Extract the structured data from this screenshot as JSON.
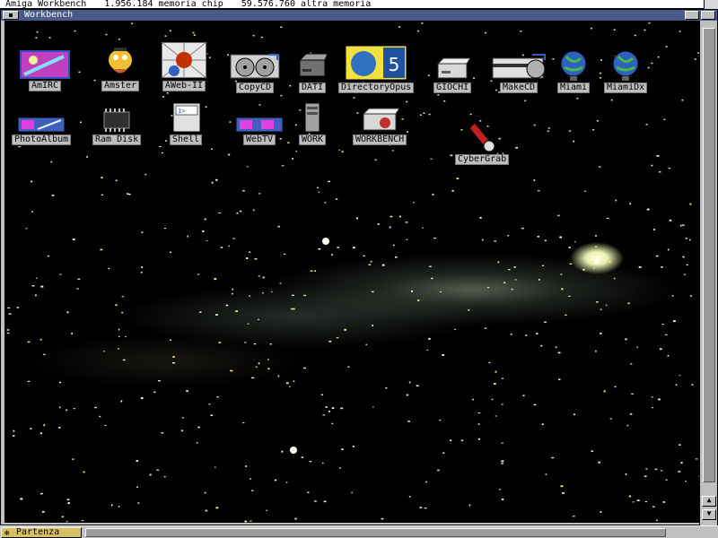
{
  "screen": {
    "title": "Amiga Workbench",
    "chip_memory": "1.956.184 memoria chip",
    "other_memory": "59.576.760 altra memoria"
  },
  "window": {
    "title": "Workbench"
  },
  "icons": [
    {
      "label": "AmIRC",
      "icon": "amirc-icon"
    },
    {
      "label": "Amster",
      "icon": "amster-icon"
    },
    {
      "label": "AWeb-II",
      "icon": "aweb-icon"
    },
    {
      "label": "CopyCD",
      "icon": "copycd-icon"
    },
    {
      "label": "DATI",
      "icon": "drive-icon"
    },
    {
      "label": "DirectoryOpus",
      "icon": "dopus-icon"
    },
    {
      "label": "GIOCHI",
      "icon": "drive-icon"
    },
    {
      "label": "MakeCD",
      "icon": "makecd-icon"
    },
    {
      "label": "Miami",
      "icon": "globe-icon"
    },
    {
      "label": "MiamiDx",
      "icon": "globe-icon"
    },
    {
      "label": "PhotoAlbum",
      "icon": "photoalbum-icon"
    },
    {
      "label": "Ram Disk",
      "icon": "chip-icon"
    },
    {
      "label": "Shell",
      "icon": "shell-icon"
    },
    {
      "label": "WebTV",
      "icon": "webtv-icon"
    },
    {
      "label": "WORK",
      "icon": "drive-tower-icon"
    },
    {
      "label": "WORKBENCH",
      "icon": "workbench-drive-icon"
    },
    {
      "label": "CyberGrab",
      "icon": "cybergrab-icon"
    }
  ],
  "taskbar": {
    "start_label": "Partenza"
  }
}
